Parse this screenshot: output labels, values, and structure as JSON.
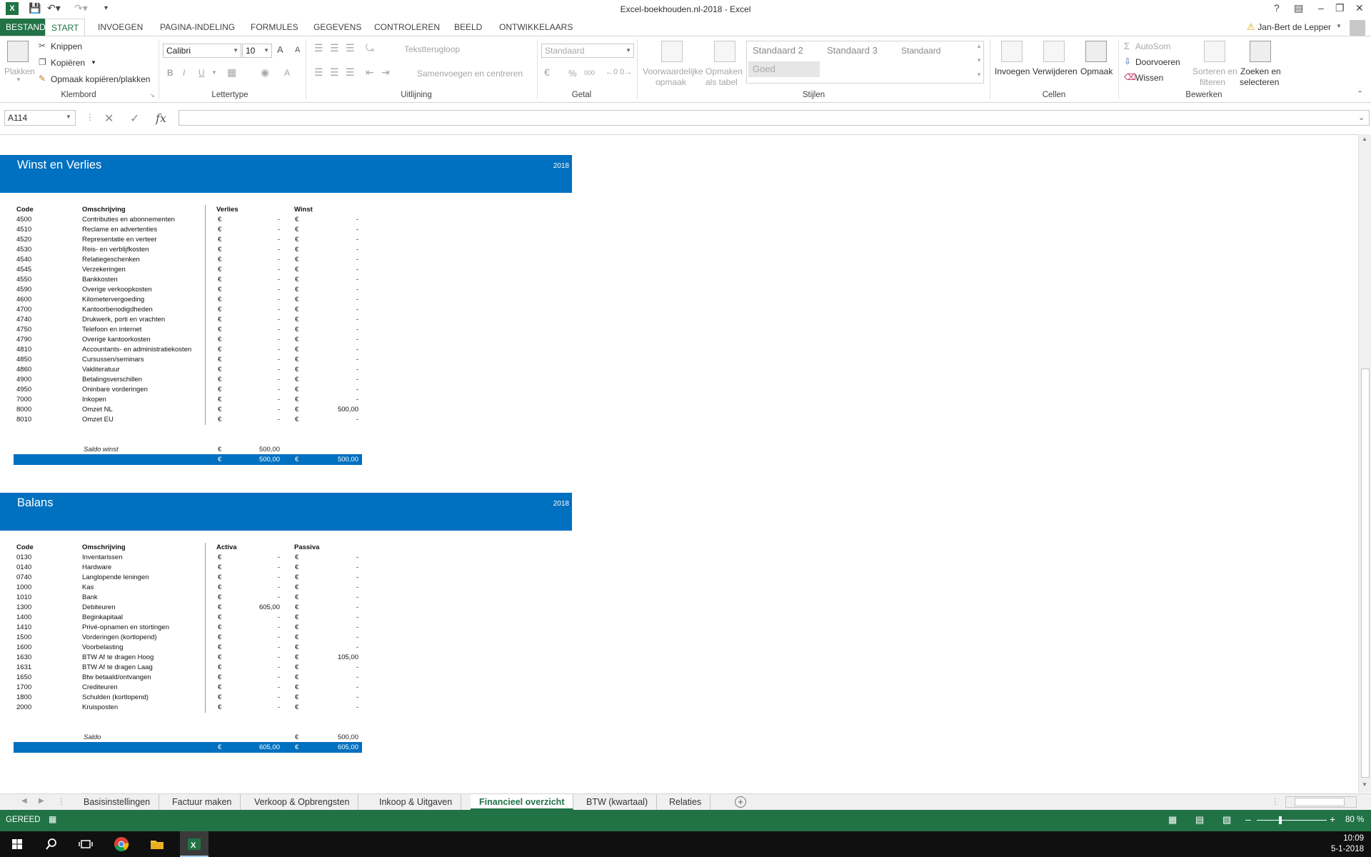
{
  "window": {
    "title": "Excel-boekhouden.nl-2018 - Excel",
    "app_icon": "X",
    "user": "Jan-Bert de Lepper",
    "help": "?"
  },
  "ribbon_tabs": [
    "BESTAND",
    "START",
    "INVOEGEN",
    "PAGINA-INDELING",
    "FORMULES",
    "GEGEVENS",
    "CONTROLEREN",
    "BEELD",
    "ONTWIKKELAARS"
  ],
  "ribbon": {
    "clipboard": {
      "paste": "Plakken",
      "cut": "Knippen",
      "copy": "Kopiëren",
      "format_painter": "Opmaak kopiëren/plakken",
      "label": "Klembord"
    },
    "font": {
      "name": "Calibri",
      "size": "10",
      "bold": "B",
      "italic": "I",
      "underline": "U",
      "font_color": "A",
      "grow": "A",
      "shrink": "A",
      "label": "Lettertype"
    },
    "alignment": {
      "wrap": "Tekstterugloop",
      "merge": "Samenvoegen en centreren",
      "label": "Uitlijning"
    },
    "number": {
      "format": "Standaard",
      "percent": "%",
      "thousands": "000",
      "label": "Getal"
    },
    "styles": {
      "conditional": "Voorwaardelijke",
      "conditional2": "opmaak",
      "table": "Opmaken",
      "table2": "als tabel",
      "s1": "Standaard 2",
      "s2": "Standaard 3",
      "s3": "Standaard",
      "s4": "Goed",
      "label": "Stijlen"
    },
    "cells": {
      "insert": "Invoegen",
      "delete": "Verwijderen",
      "format": "Opmaak",
      "label": "Cellen"
    },
    "editing": {
      "autosum": "AutoSom",
      "fill": "Doorvoeren",
      "clear": "Wissen",
      "sort": "Sorteren en",
      "sort2": "filteren",
      "find": "Zoeken en",
      "find2": "selecteren",
      "label": "Bewerken"
    }
  },
  "formula_bar": {
    "name_box": "A114",
    "formula": "",
    "fx": "fx"
  },
  "winst_verlies": {
    "title": "Winst en Verlies",
    "year": "2018",
    "headers": {
      "code": "Code",
      "desc": "Omschrijving",
      "col1": "Verlies",
      "col2": "Winst"
    },
    "rows": [
      {
        "code": "4500",
        "desc": "Contributies en abonnementen",
        "v1": "-",
        "v2": "-"
      },
      {
        "code": "4510",
        "desc": "Reclame en advertenties",
        "v1": "-",
        "v2": "-"
      },
      {
        "code": "4520",
        "desc": "Representatie en verteer",
        "v1": "-",
        "v2": "-"
      },
      {
        "code": "4530",
        "desc": "Reis- en verblijfkosten",
        "v1": "-",
        "v2": "-"
      },
      {
        "code": "4540",
        "desc": "Relatiegeschenken",
        "v1": "-",
        "v2": "-"
      },
      {
        "code": "4545",
        "desc": "Verzekeringen",
        "v1": "-",
        "v2": "-"
      },
      {
        "code": "4550",
        "desc": "Bankkosten",
        "v1": "-",
        "v2": "-"
      },
      {
        "code": "4590",
        "desc": "Overige verkoopkosten",
        "v1": "-",
        "v2": "-"
      },
      {
        "code": "4600",
        "desc": "Kilometervergoeding",
        "v1": "-",
        "v2": "-"
      },
      {
        "code": "4700",
        "desc": "Kantoorbenodigdheden",
        "v1": "-",
        "v2": "-"
      },
      {
        "code": "4740",
        "desc": "Drukwerk, porti en vrachten",
        "v1": "-",
        "v2": "-"
      },
      {
        "code": "4750",
        "desc": "Telefoon en internet",
        "v1": "-",
        "v2": "-"
      },
      {
        "code": "4790",
        "desc": "Overige kantoorkosten",
        "v1": "-",
        "v2": "-"
      },
      {
        "code": "4810",
        "desc": "Accountants- en administratiekosten",
        "v1": "-",
        "v2": "-"
      },
      {
        "code": "4850",
        "desc": "Cursussen/seminars",
        "v1": "-",
        "v2": "-"
      },
      {
        "code": "4860",
        "desc": "Vakliteratuur",
        "v1": "-",
        "v2": "-"
      },
      {
        "code": "4900",
        "desc": "Betalingsverschillen",
        "v1": "-",
        "v2": "-"
      },
      {
        "code": "4950",
        "desc": "Oninbare vorderingen",
        "v1": "-",
        "v2": "-"
      },
      {
        "code": "7000",
        "desc": "Inkopen",
        "v1": "-",
        "v2": "-"
      },
      {
        "code": "8000",
        "desc": "Omzet NL",
        "v1": "-",
        "v2": "500,00"
      },
      {
        "code": "8010",
        "desc": "Omzet EU",
        "v1": "-",
        "v2": "-"
      }
    ],
    "currency": "€",
    "saldo": {
      "label": "Saldo winst",
      "value": "500,00"
    },
    "total": {
      "v1": "500,00",
      "v2": "500,00"
    }
  },
  "balans": {
    "title": "Balans",
    "year": "2018",
    "headers": {
      "code": "Code",
      "desc": "Omschrijving",
      "col1": "Activa",
      "col2": "Passiva"
    },
    "rows": [
      {
        "code": "0130",
        "desc": "Inventarissen",
        "v1": "-",
        "v2": "-"
      },
      {
        "code": "0140",
        "desc": "Hardware",
        "v1": "-",
        "v2": "-"
      },
      {
        "code": "0740",
        "desc": "Langlopende leningen",
        "v1": "-",
        "v2": "-"
      },
      {
        "code": "1000",
        "desc": "Kas",
        "v1": "-",
        "v2": "-"
      },
      {
        "code": "1010",
        "desc": "Bank",
        "v1": "-",
        "v2": "-"
      },
      {
        "code": "1300",
        "desc": "Debiteuren",
        "v1": "605,00",
        "v2": "-"
      },
      {
        "code": "1400",
        "desc": "Beginkapitaal",
        "v1": "-",
        "v2": "-"
      },
      {
        "code": "1410",
        "desc": "Privé-opnamen en stortingen",
        "v1": "-",
        "v2": "-"
      },
      {
        "code": "1500",
        "desc": "Vorderingen (kortlopend)",
        "v1": "-",
        "v2": "-"
      },
      {
        "code": "1600",
        "desc": "Voorbelasting",
        "v1": "-",
        "v2": "-"
      },
      {
        "code": "1630",
        "desc": "BTW Af te dragen Hoog",
        "v1": "-",
        "v2": "105,00"
      },
      {
        "code": "1631",
        "desc": "BTW Af te dragen Laag",
        "v1": "-",
        "v2": "-"
      },
      {
        "code": "1650",
        "desc": "Btw betaald/ontvangen",
        "v1": "-",
        "v2": "-"
      },
      {
        "code": "1700",
        "desc": "Crediteuren",
        "v1": "-",
        "v2": "-"
      },
      {
        "code": "1800",
        "desc": "Schulden (kortlopend)",
        "v1": "-",
        "v2": "-"
      },
      {
        "code": "2000",
        "desc": "Kruisposten",
        "v1": "-",
        "v2": "-"
      }
    ],
    "currency": "€",
    "saldo": {
      "label": "Saldo",
      "value": "500,00"
    },
    "total": {
      "v1": "605,00",
      "v2": "605,00"
    }
  },
  "sheet_tabs": [
    "Basisinstellingen",
    "Factuur maken",
    "Verkoop & Opbrengsten",
    "Inkoop & Uitgaven",
    "Financieel overzicht",
    "BTW (kwartaal)",
    "Relaties"
  ],
  "active_sheet": "Financieel overzicht",
  "status": {
    "mode": "GEREED",
    "zoom": "80 %"
  },
  "clock": {
    "time": "10:09",
    "date": "5-1-2018"
  },
  "colors": {
    "excel_green": "#217346",
    "banner_blue": "#0070c0"
  }
}
